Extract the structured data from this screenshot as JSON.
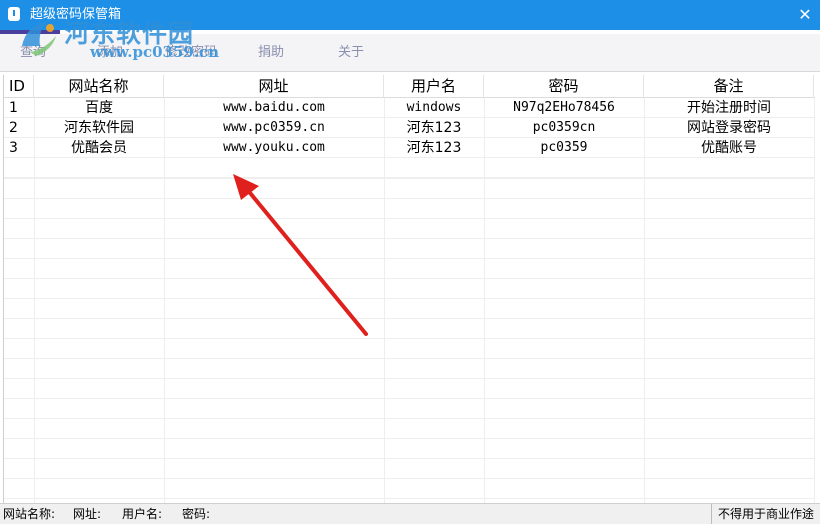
{
  "window": {
    "title": "超级密码保管箱"
  },
  "watermark": {
    "name": "河东软件园",
    "url": "www.pc0359.cn"
  },
  "menu": {
    "items": [
      "查询",
      "添加",
      "修改密码",
      "捐助",
      "关于"
    ]
  },
  "table": {
    "headers": [
      "ID",
      "网站名称",
      "网址",
      "用户名",
      "密码",
      "备注"
    ],
    "rows": [
      [
        "1",
        "百度",
        "www.baidu.com",
        "windows",
        "N97q2EHo78456",
        "开始注册时间"
      ],
      [
        "2",
        "河东软件园",
        "www.pc0359.cn",
        "河东123",
        "pc0359cn",
        "网站登录密码"
      ],
      [
        "3",
        "优酷会员",
        "www.youku.com",
        "河东123",
        "pc0359",
        "优酷账号"
      ]
    ]
  },
  "status": {
    "site_label": "网站名称:",
    "url_label": "网址:",
    "user_label": "用户名:",
    "password_label": "密码:",
    "notice": "不得用于商业作途"
  },
  "colors": {
    "titlebar": "#1e8fe6",
    "arrow": "#e0201c",
    "watermark": "#2f8fd8"
  }
}
